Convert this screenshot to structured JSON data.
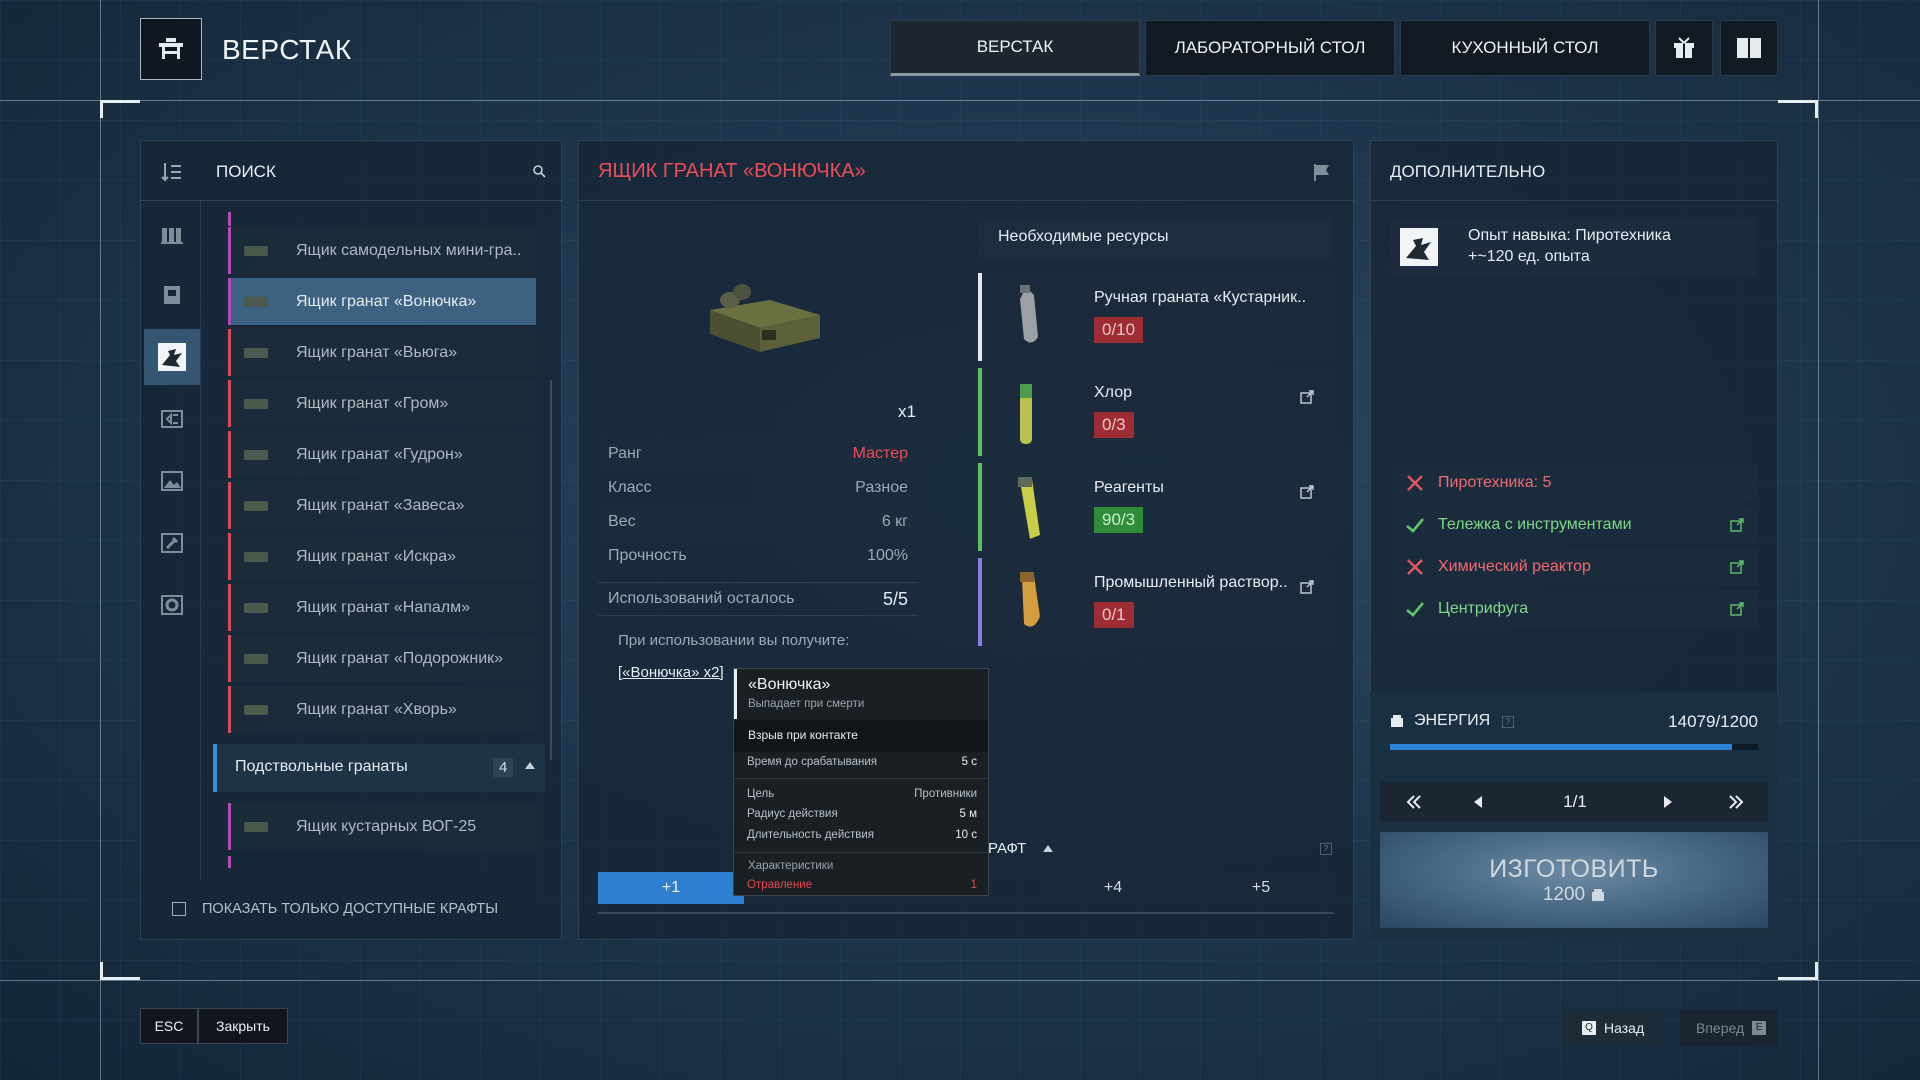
{
  "header": {
    "title": "ВЕРСТАК",
    "tabs": [
      "ВЕРСТАК",
      "ЛАБОРАТОРНЫЙ СТОЛ",
      "КУХОННЫЙ СТОЛ"
    ]
  },
  "left": {
    "search_label": "ПОИСК",
    "items": [
      {
        "label": "Ящик самодельных мини-гра..",
        "color": "#b04bb5"
      },
      {
        "label": "Ящик гранат «Вонючка»",
        "color": "#b04bb5"
      },
      {
        "label": "Ящик гранат «Вьюга»",
        "color": "#d84a56"
      },
      {
        "label": "Ящик гранат «Гром»",
        "color": "#d84a56"
      },
      {
        "label": "Ящик гранат «Гудрон»",
        "color": "#d84a56"
      },
      {
        "label": "Ящик гранат «Завеса»",
        "color": "#d84a56"
      },
      {
        "label": "Ящик гранат «Искра»",
        "color": "#d84a56"
      },
      {
        "label": "Ящик гранат «Напалм»",
        "color": "#d84a56"
      },
      {
        "label": "Ящик гранат «Подорожник»",
        "color": "#d84a56"
      },
      {
        "label": "Ящик гранат «Хворь»",
        "color": "#d84a56"
      }
    ],
    "category": {
      "label": "Подствольные гранаты",
      "count": "4"
    },
    "sub_item": {
      "label": "Ящик кустарных ВОГ-25",
      "color": "#b04bb5"
    },
    "show_available": "ПОКАЗАТЬ ТОЛЬКО ДОСТУПНЫЕ КРАФТЫ"
  },
  "item": {
    "title": "ЯЩИК ГРАНАТ «ВОНЮЧКА»",
    "quantity": "x1",
    "stats": [
      {
        "label": "Ранг",
        "value": "Мастер"
      },
      {
        "label": "Класс",
        "value": "Разное"
      },
      {
        "label": "Вес",
        "value": "6 кг"
      },
      {
        "label": "Прочность",
        "value": "100%"
      }
    ],
    "uses_label": "Использований осталось",
    "uses_value": "5/5",
    "receive_label": "При использовании вы получите:",
    "receive_link": "[«Вонючка» x2]",
    "craft_label": "РАФТ",
    "tabs": [
      "+1",
      "+4",
      "+5"
    ]
  },
  "tooltip": {
    "title": "«Вонючка»",
    "subtitle": "Выпадает при смерти",
    "type": "Взрыв при контакте",
    "rows": [
      {
        "label": "Время до срабатывания",
        "value": "5 с"
      },
      {
        "label": "Цель",
        "value": "Противники"
      },
      {
        "label": "Радиус действия",
        "value": "5 м"
      },
      {
        "label": "Длительность действия",
        "value": "10 с"
      }
    ],
    "char_label": "Характеристики",
    "char_name": "Отравление",
    "char_value": "1"
  },
  "resources": {
    "title": "Необходимые ресурсы",
    "items": [
      {
        "name": "Ручная граната «Кустарник..",
        "count": "0/10",
        "ok": false,
        "color": "#e8e8e8"
      },
      {
        "name": "Хлор",
        "count": "0/3",
        "ok": false,
        "color": "#5fbf5f"
      },
      {
        "name": "Реагенты",
        "count": "90/3",
        "ok": true,
        "color": "#5fbf5f"
      },
      {
        "name": "Промышленный раствор..",
        "count": "0/1",
        "ok": false,
        "color": "#8a7fe0"
      }
    ]
  },
  "extra": {
    "title": "ДОПОЛНИТЕЛЬНО",
    "skill_line1": "Опыт навыка: Пиротехника",
    "skill_line2": "+~120 ед. опыта",
    "requirements": [
      {
        "label": "Пиротехника: 5",
        "ok": false
      },
      {
        "label": "Тележка с инструментами",
        "ok": true
      },
      {
        "label": "Химический реактор",
        "ok": false
      },
      {
        "label": "Центрифуга",
        "ok": true
      }
    ],
    "energy_label": "ЭНЕРГИЯ",
    "energy_value": "14079/1200",
    "energy_fill": 0.93,
    "page": "1/1",
    "craft_button": "ИЗГОТОВИТЬ",
    "craft_cost": "1200"
  },
  "footer": {
    "esc": "ESC",
    "close": "Закрыть",
    "back_key": "Q",
    "back": "Назад",
    "forward": "Вперед",
    "forward_key": "E"
  }
}
